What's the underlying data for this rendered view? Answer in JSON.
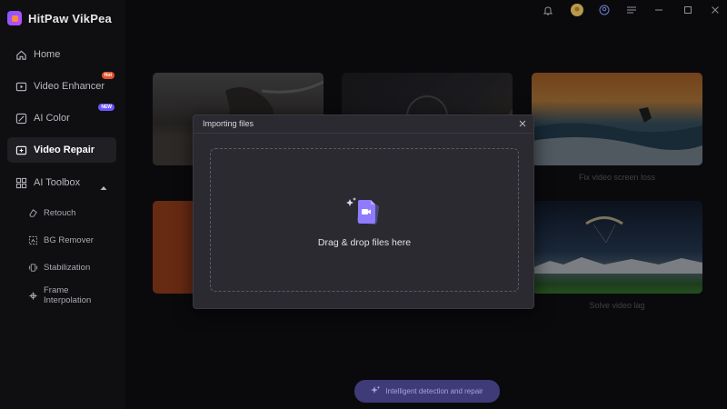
{
  "app": {
    "name": "HitPaw VikPea"
  },
  "sidebar": {
    "items": [
      {
        "label": "Home",
        "icon": "home-icon"
      },
      {
        "label": "Video Enhancer",
        "icon": "video-enhancer-icon",
        "badge": "Hot"
      },
      {
        "label": "AI Color",
        "icon": "ai-color-icon",
        "badge": "NEW"
      },
      {
        "label": "Video Repair",
        "icon": "video-repair-icon",
        "active": true
      },
      {
        "label": "AI Toolbox",
        "icon": "ai-toolbox-icon",
        "expanded": true
      }
    ],
    "subitems": [
      {
        "label": "Retouch",
        "icon": "eraser-icon"
      },
      {
        "label": "BG Remover",
        "icon": "bg-remover-icon"
      },
      {
        "label": "Stabilization",
        "icon": "stabilization-icon"
      },
      {
        "label": "Frame Interpolation",
        "icon": "frame-interpolation-icon"
      }
    ]
  },
  "titlebar": {
    "icons": [
      "bell-icon",
      "avatar",
      "user-circle-icon",
      "menu-icon",
      "minimize-icon",
      "maximize-icon",
      "close-icon"
    ]
  },
  "cards": [
    {
      "caption": ""
    },
    {
      "caption": ""
    },
    {
      "caption": "Fix video screen loss"
    },
    {
      "caption": ""
    },
    {
      "caption": "Solve video lag"
    }
  ],
  "dialog": {
    "title": "Importing files",
    "drop_text": "Drag & drop files here"
  },
  "footer": {
    "detect_label": "Intelligent detection and repair"
  },
  "colors": {
    "accent": "#6a55ff",
    "hot_badge": "#e0532e",
    "button_bg": "#3f3a78"
  }
}
